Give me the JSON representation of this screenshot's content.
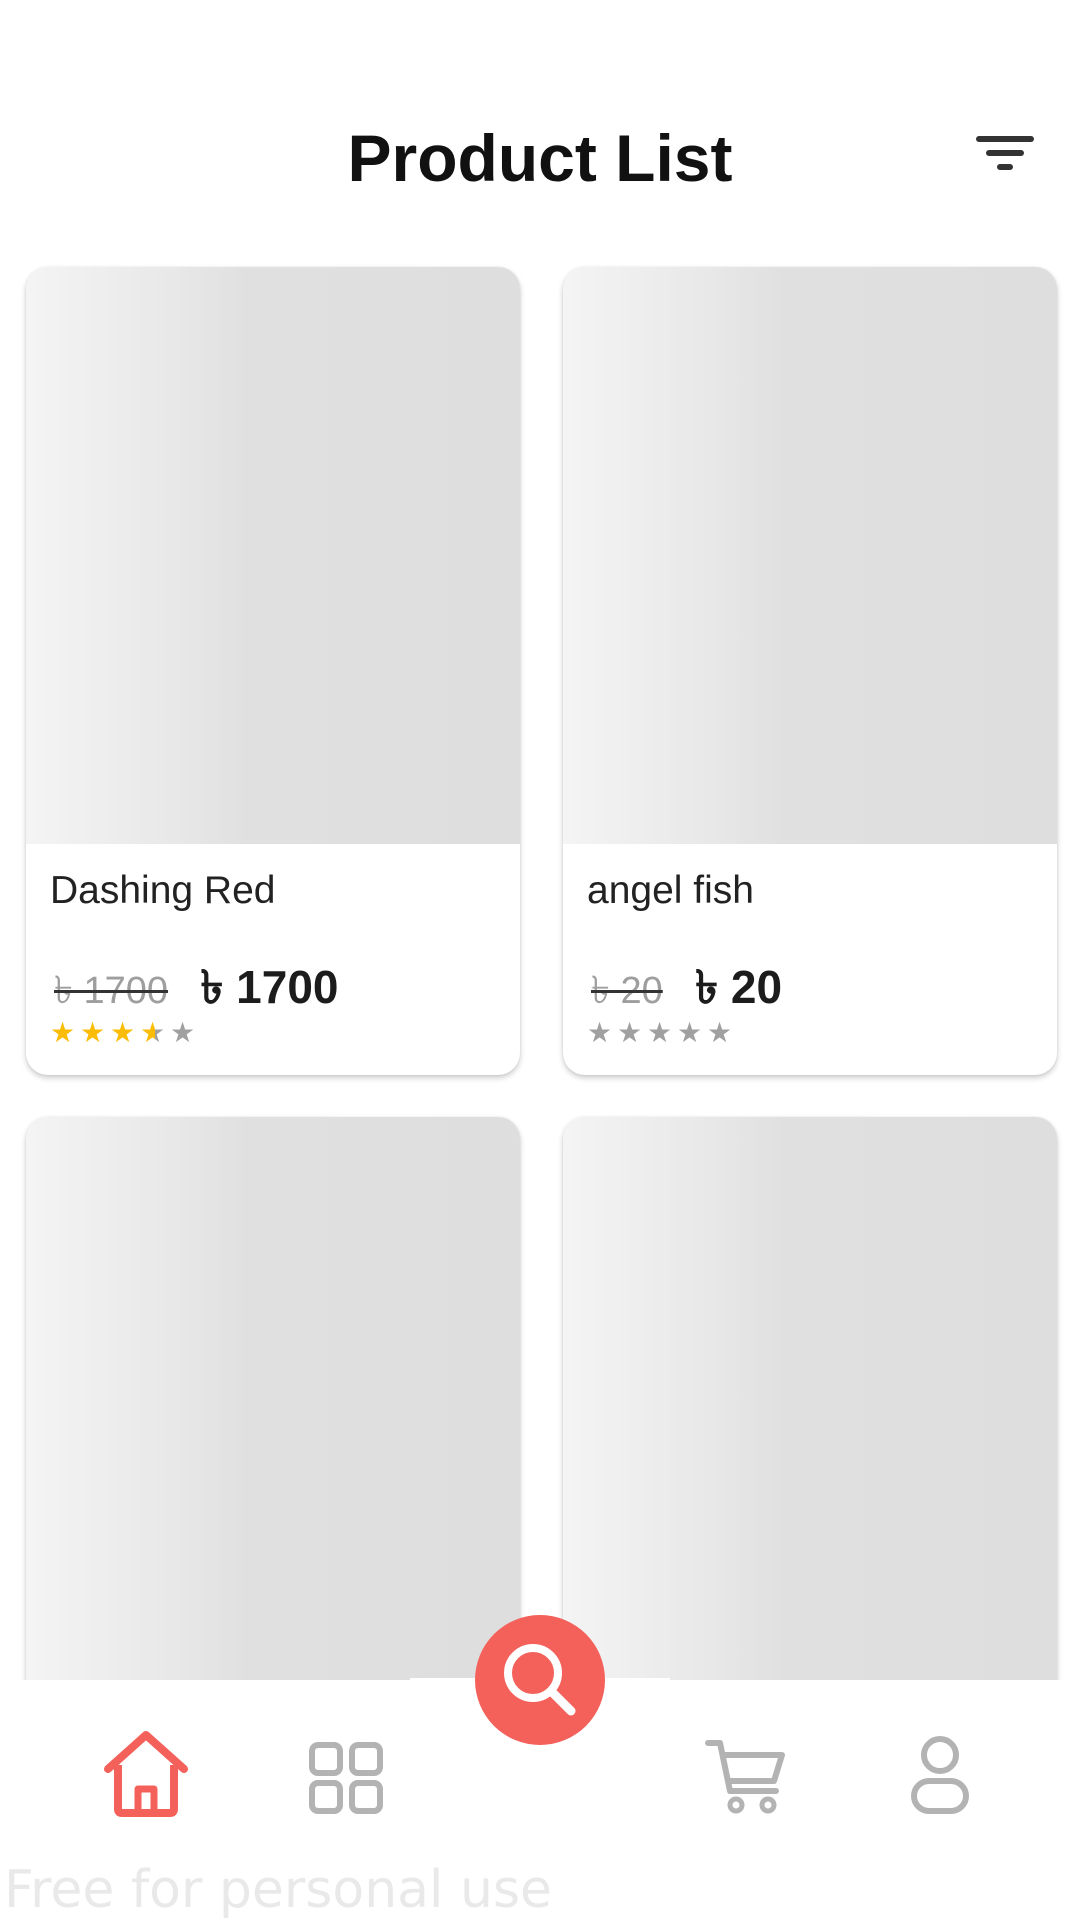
{
  "header": {
    "title": "Product List",
    "filter_icon": "filter-icon"
  },
  "products": [
    {
      "name": "Dashing Red",
      "old_price": "৳ 1700",
      "price": "৳ 1700",
      "rating": 3.5
    },
    {
      "name": "angel fish",
      "old_price": "৳ 20",
      "price": "৳ 20",
      "rating": 0
    },
    {
      "name": "",
      "old_price": "",
      "price": "",
      "rating": 0
    },
    {
      "name": "",
      "old_price": "",
      "price": "",
      "rating": 0
    }
  ],
  "bottom_nav": {
    "items": [
      {
        "icon": "home-icon",
        "active": true
      },
      {
        "icon": "grid-icon",
        "active": false
      },
      {
        "icon": "cart-icon",
        "active": false
      },
      {
        "icon": "profile-icon",
        "active": false
      }
    ],
    "fab_icon": "search-icon"
  },
  "colors": {
    "accent": "#f4605a",
    "star": "#fbbc05",
    "star_empty": "#a0a0a0",
    "inactive_icon": "#b3b3b3"
  },
  "watermark": "Free for personal use"
}
